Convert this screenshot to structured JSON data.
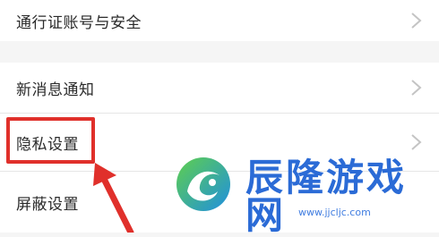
{
  "settings": {
    "items": [
      {
        "label": "通行证账号与安全",
        "icon": "chevron-right-icon"
      },
      {
        "label": "新消息通知",
        "icon": "chevron-right-icon"
      },
      {
        "label": "隐私设置",
        "icon": "chevron-right-icon"
      },
      {
        "label": "屏蔽设置",
        "icon": "chevron-right-icon"
      }
    ]
  },
  "annotation": {
    "highlight_color": "#e0302b"
  },
  "watermark": {
    "brand": "辰隆游戏网",
    "url": "www.jjcljc.com",
    "brand_color": "#2b6bd6",
    "logo_colors": [
      "#1f8fe0",
      "#5fcf4d"
    ]
  }
}
